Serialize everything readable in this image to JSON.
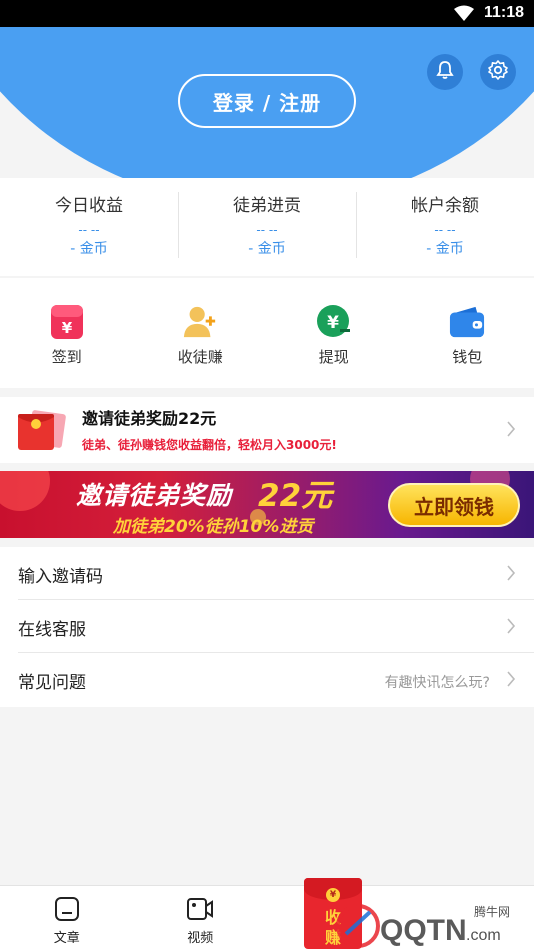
{
  "status_bar": {
    "time": "11:18"
  },
  "header": {
    "login_label": "登录 / 注册",
    "accent": "#4a9ff2"
  },
  "stats": [
    {
      "label": "今日收益",
      "value": "-- --",
      "unit": "- 金币"
    },
    {
      "label": "徒弟进贡",
      "value": "-- --",
      "unit": "- 金币"
    },
    {
      "label": "帐户余额",
      "value": "-- --",
      "unit": "- 金币"
    }
  ],
  "quick_actions": [
    {
      "label": "签到",
      "icon": "checkin-icon"
    },
    {
      "label": "收徒赚",
      "icon": "add-apprentice-icon"
    },
    {
      "label": "提现",
      "icon": "withdraw-icon"
    },
    {
      "label": "钱包",
      "icon": "wallet-icon"
    }
  ],
  "invite": {
    "title": "邀请徒弟奖励22元",
    "subtitle": "徒弟、徒孙赚钱您收益翻倍，轻松月入3000元!"
  },
  "banner": {
    "title": "邀请徒弟奖励",
    "amount": "22元",
    "subtitle": "加徒弟20%徒孙10%进贡",
    "cta": "立即领钱"
  },
  "menu": [
    {
      "label": "输入邀请码",
      "hint": ""
    },
    {
      "label": "在线客服",
      "hint": ""
    },
    {
      "label": "常见问题",
      "hint": "有趣快讯怎么玩?"
    }
  ],
  "bottom_nav": {
    "items": [
      {
        "label": "文章",
        "icon": "article-icon"
      },
      {
        "label": "视频",
        "icon": "video-icon"
      }
    ],
    "center_label": "收徒赚钱",
    "center_label_top": "收",
    "center_label_bottom": "赚"
  },
  "watermark": {
    "text": "QQTN.com",
    "sub": "腾牛网"
  }
}
